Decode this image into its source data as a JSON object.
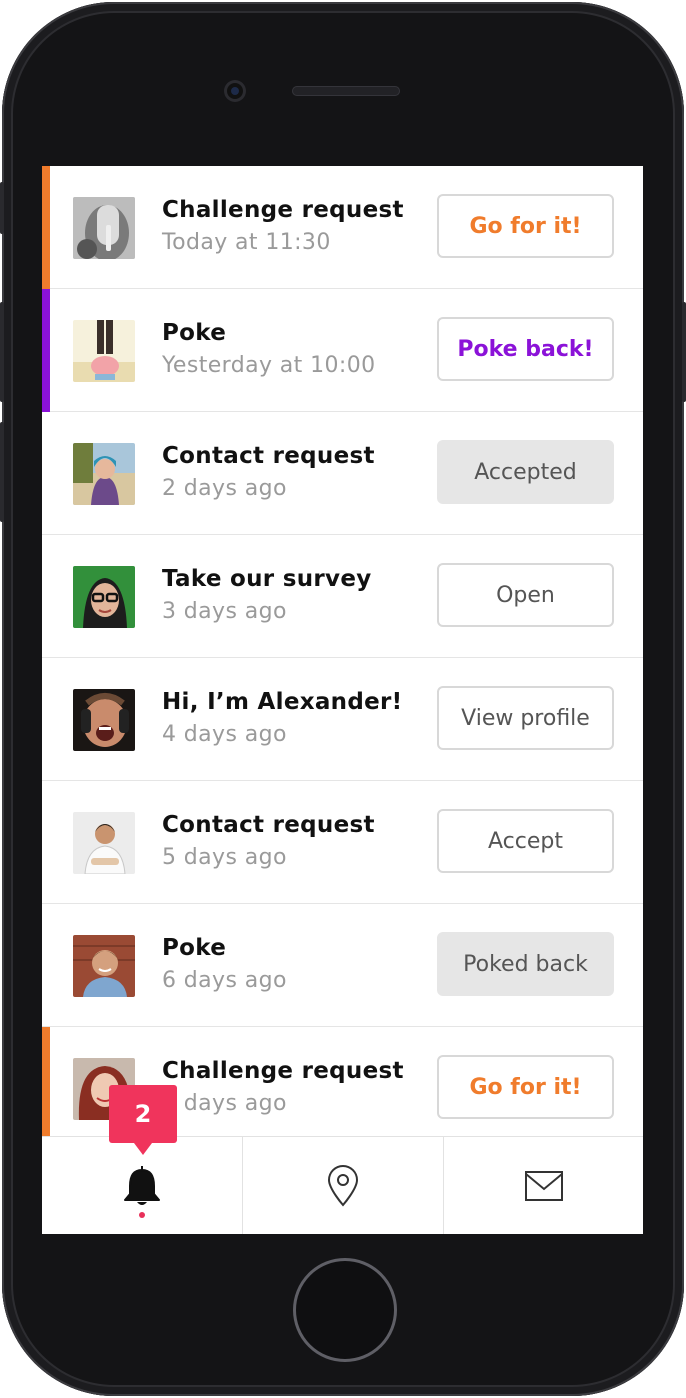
{
  "accent_colors": {
    "orange": "#f07c2c",
    "purple": "#8b12d8",
    "badge": "#f0345c"
  },
  "notifications": [
    {
      "title": "Challenge request",
      "time": "Today at 11:30",
      "action": "Go for it!",
      "accent": "orange"
    },
    {
      "title": "Poke",
      "time": "Yesterday at 10:00",
      "action": "Poke back!",
      "accent": "purple"
    },
    {
      "title": "Contact request",
      "time": "2 days ago",
      "action": "Accepted",
      "state": "done"
    },
    {
      "title": "Take our survey",
      "time": "3 days ago",
      "action": "Open"
    },
    {
      "title": "Hi, I’m Alexander!",
      "time": "4 days ago",
      "action": "View profile"
    },
    {
      "title": "Contact request",
      "time": "5 days ago",
      "action": "Accept"
    },
    {
      "title": "Poke",
      "time": "6 days ago",
      "action": "Poked back",
      "state": "done"
    },
    {
      "title": "Challenge request",
      "time": "7 days ago",
      "action": "Go for it!",
      "accent": "orange"
    }
  ],
  "tabbar": {
    "badge_count": "2",
    "tabs": [
      {
        "icon": "bell-icon",
        "active": true
      },
      {
        "icon": "map-pin-icon",
        "active": false
      },
      {
        "icon": "mail-icon",
        "active": false
      }
    ]
  }
}
